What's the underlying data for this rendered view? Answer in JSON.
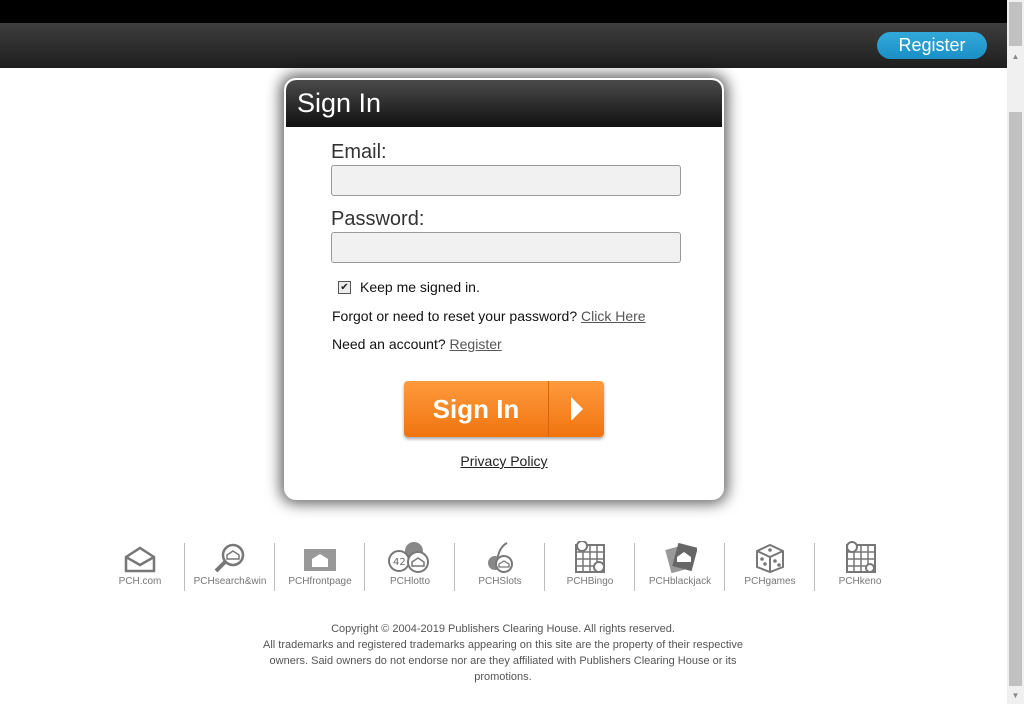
{
  "header": {
    "register_label": "Register"
  },
  "signin": {
    "title": "Sign In",
    "email_label": "Email:",
    "email_value": "",
    "password_label": "Password:",
    "password_value": "",
    "keep_signed_in_label": "Keep me signed in.",
    "keep_signed_in_checked": true,
    "forgot_text": "Forgot or need to reset your password?",
    "forgot_link": "Click Here",
    "need_account_text": "Need an account?",
    "register_link": "Register",
    "button_label": "Sign In",
    "privacy_link": "Privacy Policy"
  },
  "footer_icons": [
    {
      "label": "PCH.com",
      "icon": "envelope-icon"
    },
    {
      "label": "PCHsearch&win",
      "icon": "magnifier-icon"
    },
    {
      "label": "PCHfrontpage",
      "icon": "frontpage-icon"
    },
    {
      "label": "PCHlotto",
      "icon": "lotto-balls-icon"
    },
    {
      "label": "PCHSlots",
      "icon": "cherries-icon"
    },
    {
      "label": "PCHBingo",
      "icon": "bingo-card-icon"
    },
    {
      "label": "PCHblackjack",
      "icon": "cards-icon"
    },
    {
      "label": "PCHgames",
      "icon": "dice-icon"
    },
    {
      "label": "PCHkeno",
      "icon": "keno-grid-icon"
    }
  ],
  "footer": {
    "copyright_line": "Copyright © 2004-2019 Publishers Clearing House. All rights reserved.",
    "trademark_text": "All trademarks and registered trademarks appearing on this site are the property of their respective owners. Said owners do not endorse nor are they affiliated with Publishers Clearing House or its promotions."
  },
  "colors": {
    "accent_orange": "#f07410",
    "register_blue": "#1b8fc6",
    "header_dark": "#1e1e1e"
  }
}
